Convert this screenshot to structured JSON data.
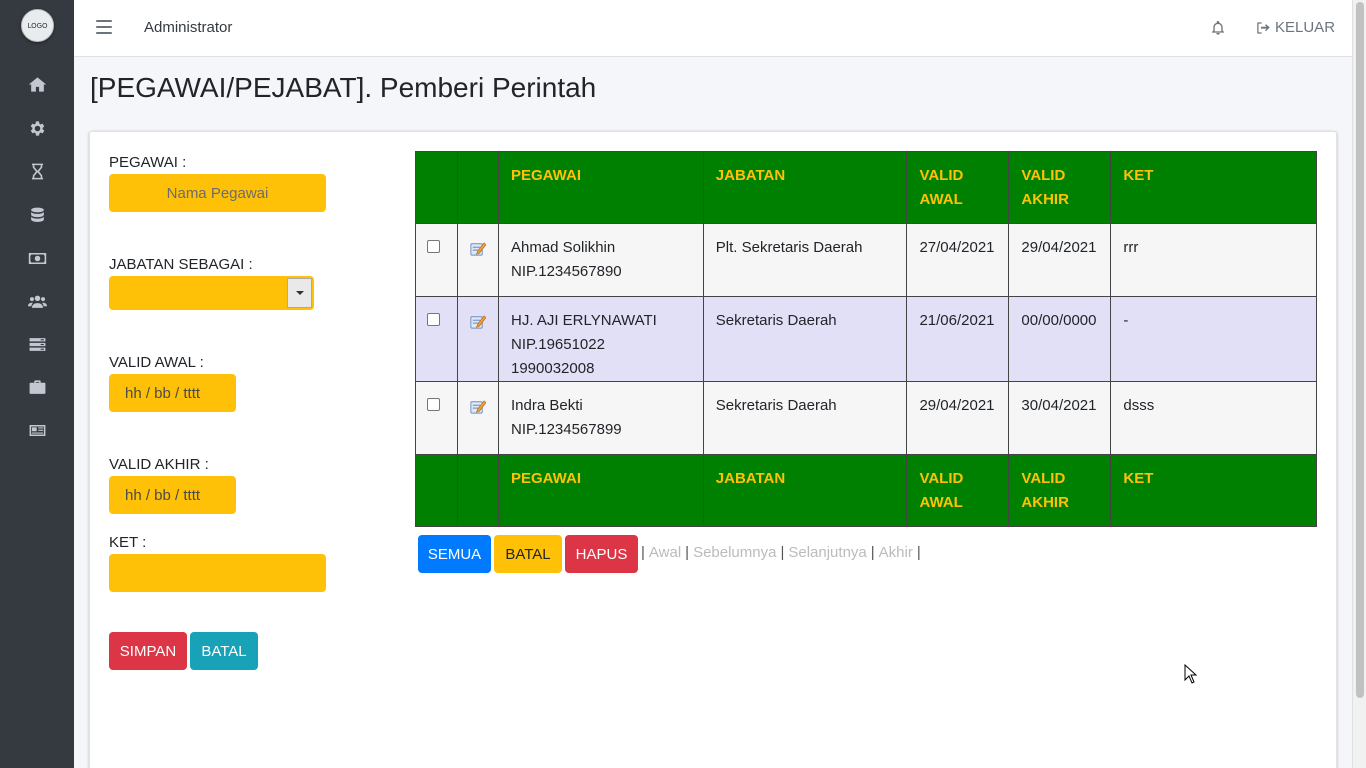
{
  "sidebar": {
    "logo_text": "LOGO",
    "icons": [
      "home-icon",
      "gear-icon",
      "hourglass-icon",
      "database-icon",
      "money-icon",
      "users-icon",
      "server-icon",
      "briefcase-icon",
      "newspaper-icon"
    ]
  },
  "topbar": {
    "admin_label": "Administrator",
    "logout_label": "KELUAR"
  },
  "page": {
    "title": "[PEGAWAI/PEJABAT]. Pemberi Perintah"
  },
  "form": {
    "pegawai_label": "PEGAWAI :",
    "pegawai_placeholder": "Nama Pegawai",
    "jabatan_label": "JABATAN SEBAGAI :",
    "jabatan_value": "",
    "valid_awal_label": "VALID AWAL :",
    "valid_awal_placeholder": "hh / bb / tttt",
    "valid_akhir_label": "VALID AKHIR :",
    "valid_akhir_placeholder": "hh / bb / tttt",
    "ket_label": "KET :",
    "ket_value": "",
    "simpan_label": "SIMPAN",
    "batal_label": "BATAL"
  },
  "table": {
    "headers": [
      "PEGAWAI",
      "JABATAN",
      "VALID AWAL",
      "VALID AKHIR",
      "KET"
    ],
    "header_pegawai": "PEGAWAI",
    "header_jabatan": "JABATAN",
    "header_valid_awal_1": "VALID",
    "header_valid_awal_2": "AWAL",
    "header_valid_akhir_1": "VALID",
    "header_valid_akhir_2": "AKHIR",
    "header_ket": "KET",
    "rows": [
      {
        "name": "Ahmad Solikhin",
        "nip": "NIP.1234567890",
        "jabatan": "Plt. Sekretaris Daerah",
        "valid_awal": "27/04/2021",
        "valid_akhir": "29/04/2021",
        "ket": "rrr"
      },
      {
        "name": "HJ. AJI ERLYNAWATI",
        "nip": "NIP.19651022 1990032008",
        "jabatan": "Sekretaris Daerah",
        "valid_awal": "21/06/2021",
        "valid_akhir": "00/00/0000",
        "ket": "-"
      },
      {
        "name": "Indra Bekti",
        "nip": "NIP.1234567899",
        "jabatan": "Sekretaris Daerah",
        "valid_awal": "29/04/2021",
        "valid_akhir": "30/04/2021",
        "ket": "dsss"
      }
    ]
  },
  "actions": {
    "semua_label": "SEMUA",
    "batal_label": "BATAL",
    "hapus_label": "HAPUS"
  },
  "pager": {
    "sep": "|",
    "awal": "Awal",
    "sebelumnya": "Sebelumnya",
    "selanjutnya": "Selanjutnya",
    "akhir": "Akhir"
  },
  "colors": {
    "sidebar_bg": "#343a40",
    "table_header_bg": "#008000",
    "table_header_text": "#ffc107",
    "input_bg": "#ffc107",
    "row_highlight": "#e2e0f6"
  }
}
